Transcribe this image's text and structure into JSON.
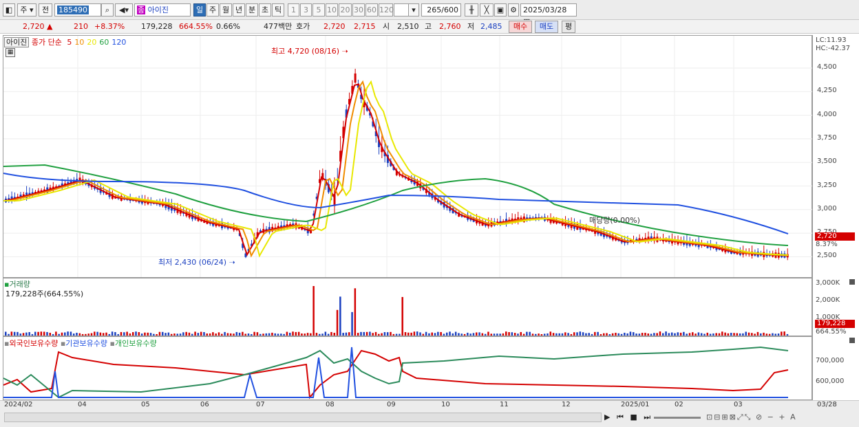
{
  "toolbar": {
    "type_code": "주",
    "prev_label": "전",
    "stock_code": "185490",
    "stock_name": "아이진",
    "stock_badge": "종",
    "periods": [
      "일",
      "주",
      "월",
      "년",
      "분",
      "초",
      "틱"
    ],
    "minute_options": [
      "1",
      "3",
      "5",
      "10",
      "20",
      "30",
      "60",
      "120"
    ],
    "bar_count": "265",
    "bar_total": "/600",
    "date": "2025/03/28"
  },
  "info": {
    "price": "2,720",
    "change": "210",
    "change_pct": "+8.37%",
    "volume": "179,228",
    "volume_ratio": "664.55%",
    "turnover": "0.66%",
    "amount": "477백만",
    "quote_label": "호가",
    "ask": "2,720",
    "bid": "2,715",
    "open_label": "시",
    "open": "2,510",
    "high_label": "고",
    "high": "2,760",
    "low_label": "저",
    "low": "2,485",
    "buy_button": "매수",
    "sell_button": "매도",
    "eval_button": "평"
  },
  "price_pane": {
    "name_box": "아이진",
    "legend_prefix": "종가 단순",
    "ma_periods": [
      "5",
      "10",
      "20",
      "60",
      "120"
    ],
    "ma_colors": [
      "#d40000",
      "#f08c00",
      "#e8e800",
      "#20a040",
      "#2050e0"
    ],
    "lc_label": "LC:11.93",
    "hc_label": "HC:-42.37",
    "price_ticks": [
      "4,500",
      "4,250",
      "4,000",
      "3,750",
      "3,500",
      "3,250",
      "3,000",
      "2,750",
      "2,500"
    ],
    "current_tag": "2,720",
    "current_pct_tag": "8.37%",
    "high_annotation": "최고 4,720 (08/16)",
    "low_annotation": "최저 2,430 (06/24)",
    "ratio_annotation": "매당량(0.00%)"
  },
  "volume_pane": {
    "title": "거래량",
    "value": "179,228주(664.55%)",
    "ticks": [
      "3,000K",
      "2,000K",
      "1,000K"
    ],
    "current_tag": "179,228",
    "current_pct_tag": "664.55%"
  },
  "holding_pane": {
    "legend": [
      "외국인보유수량",
      "기관보유수량",
      "개인보유수량"
    ],
    "legend_colors": [
      "#d40000",
      "#2050e0",
      "#20a040"
    ],
    "ticks": [
      "700,000",
      "600,000"
    ]
  },
  "time_axis": {
    "labels": [
      "2024/02",
      "04",
      "05",
      "06",
      "07",
      "08",
      "09",
      "10",
      "11",
      "12",
      "2025/01",
      "02",
      "03"
    ],
    "end_label": "03/28"
  },
  "colors": {
    "up": "#d40000",
    "down": "#1a3fc0",
    "toolbar_bg": "#ececec",
    "selected_tab": "#2d6db5"
  }
}
